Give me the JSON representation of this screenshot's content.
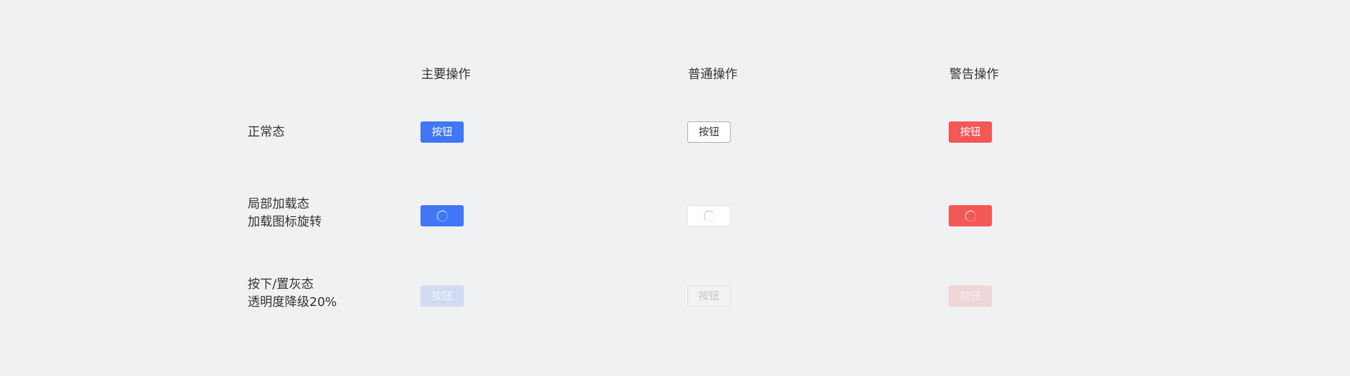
{
  "columns": {
    "primary": "主要操作",
    "normal": "普通操作",
    "warning": "警告操作"
  },
  "rows": {
    "normal_state": {
      "label_line1": "正常态"
    },
    "loading_state": {
      "label_line1": "局部加载态",
      "label_line2": "加载图标旋转"
    },
    "disabled_state": {
      "label_line1": "按下/置灰态",
      "label_line2": "透明度降级20%"
    }
  },
  "button_label": "按钮",
  "icons": {
    "loading": "loading-spinner-icon"
  },
  "colors": {
    "background": "#f0f1f3",
    "primary": "#4177f6",
    "warning": "#f35756",
    "normal_border": "#a9a9a9",
    "text": "#333333"
  }
}
